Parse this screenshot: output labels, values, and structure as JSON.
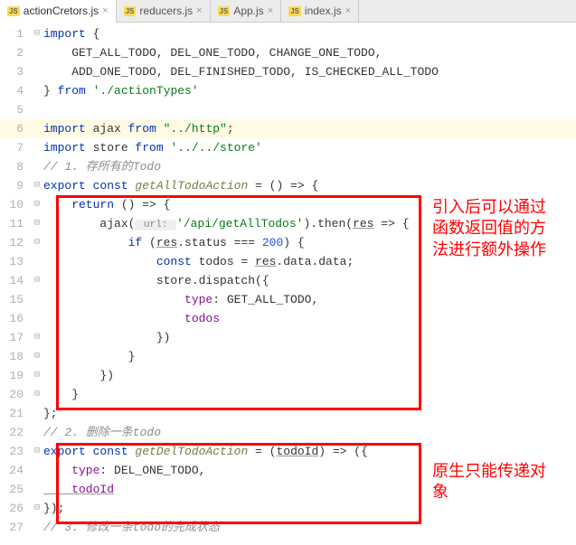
{
  "tabs": [
    {
      "label": "actionCretors.js",
      "active": true
    },
    {
      "label": "reducers.js",
      "active": false
    },
    {
      "label": "App.js",
      "active": false
    },
    {
      "label": "index.js",
      "active": false
    }
  ],
  "js_badge": "JS",
  "close_glyph": "×",
  "fold": {
    "minus": "⊟",
    "plus": "⊞",
    "end": "⊟"
  },
  "gutter_start": 1,
  "gutter_end": 27,
  "code": {
    "l1_import": "import",
    "l1_brace": " {",
    "l2": "    GET_ALL_TODO, DEL_ONE_TODO, CHANGE_ONE_TODO,",
    "l3": "    ADD_ONE_TODO, DEL_FINISHED_TODO, IS_CHECKED_ALL_TODO",
    "l4_brace": "} ",
    "l4_from": "from",
    "l4_str": " './actionTypes'",
    "l6_import": "import",
    "l6_mid": " ajax ",
    "l6_from": "from",
    "l6_str": " \"../http\"",
    "l6_semi": ";",
    "l7_import": "import",
    "l7_mid": " store ",
    "l7_from": "from",
    "l7_str": " '../../store'",
    "l8_cm": "// 1. 存所有的Todo",
    "l9_export": "export const",
    "l9_fn": " getAllTodoAction",
    "l9_rest": " = () => {",
    "l10_kw": "    return",
    "l10_rest": " () => {",
    "l11_a": "        ajax(",
    "l11_hint": " url: ",
    "l11_str": "'/api/getAllTodos'",
    "l11_b": ").then(",
    "l11_res": "res",
    "l11_c": " => {",
    "l12_a": "            if",
    "l12_b": " (",
    "l12_res": "res",
    "l12_c": ".status === ",
    "l12_num": "200",
    "l12_d": ") {",
    "l13_a": "                const",
    "l13_b": " todos = ",
    "l13_res": "res",
    "l13_c": ".data.data;",
    "l14": "                store.dispatch({",
    "l15_a": "                    type",
    "l15_b": ": GET_ALL_TODO,",
    "l16": "                    todos",
    "l17": "                })",
    "l18": "            }",
    "l19": "        })",
    "l20": "    }",
    "l21": "};",
    "l22_cm": "// 2. 删除一条todo",
    "l23_export": "export const",
    "l23_fn": " getDelTodoAction",
    "l23_a": " = (",
    "l23_param": "todoId",
    "l23_b": ") => ({",
    "l24_a": "    type",
    "l24_b": ": DEL_ONE_TODO,",
    "l25": "    todoId",
    "l26": "});",
    "l27_cm": "// 3. 修改一条todo的完成状态"
  },
  "annotations": {
    "top": "引入后可以通过函数返回值的方法进行额外操作",
    "bottom": "原生只能传递对象"
  },
  "watermark": ""
}
